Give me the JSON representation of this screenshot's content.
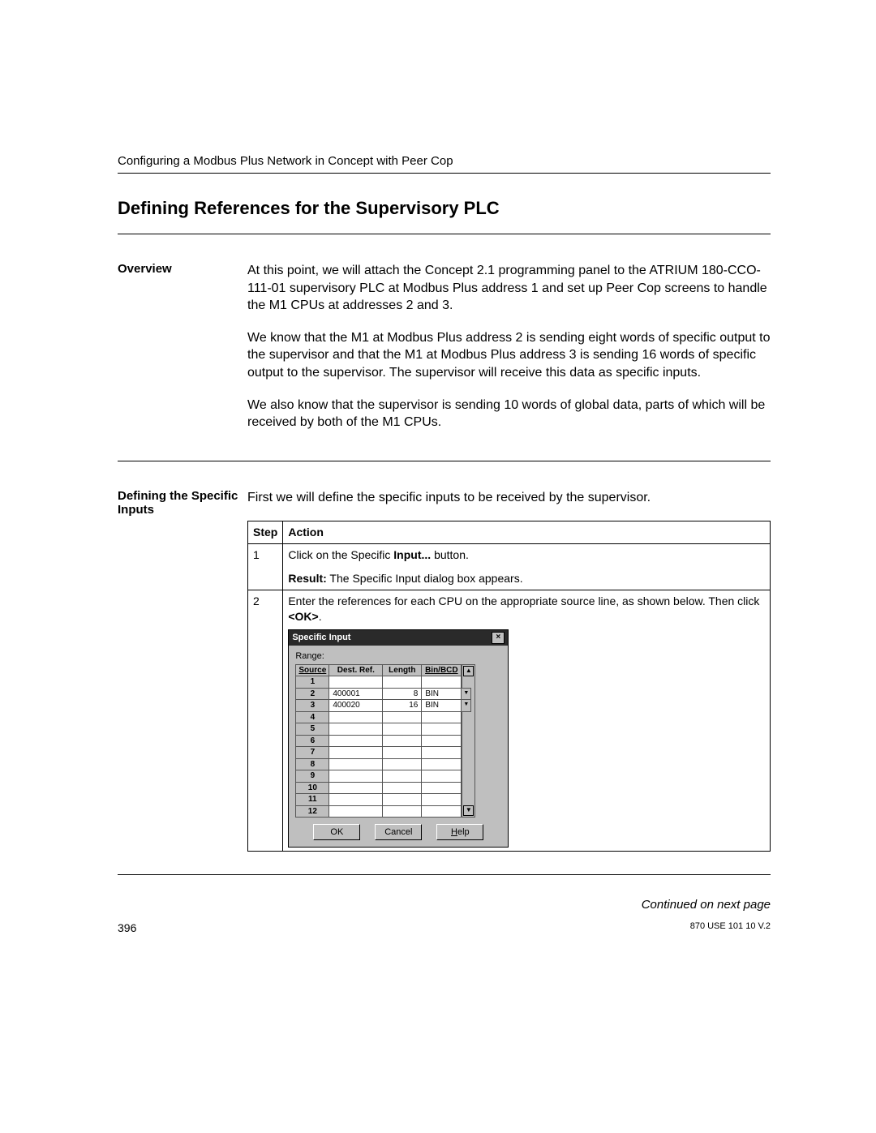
{
  "running_head": "Configuring a Modbus Plus Network in Concept with Peer Cop",
  "section_title": "Defining References for the Supervisory PLC",
  "overview": {
    "label": "Overview",
    "p1": "At this point, we will attach the Concept 2.1 programming panel to the ATRIUM 180-CCO-111-01 supervisory PLC at Modbus Plus address 1 and set up Peer Cop screens to handle the M1 CPUs at addresses 2 and 3.",
    "p2": "We know that the M1 at Modbus Plus address 2 is sending eight words of specific output to the supervisor and that the M1 at Modbus Plus address 3 is sending 16 words of specific output to the supervisor. The supervisor will receive this data as specific inputs.",
    "p3": "We also know that the supervisor is sending 10 words of global data, parts of which will be received by both of the M1 CPUs."
  },
  "specific_inputs": {
    "label": "Defining the Specific Inputs",
    "intro": "First we will define the specific inputs to be received by the supervisor.",
    "table": {
      "head_step": "Step",
      "head_action": "Action",
      "step1_num": "1",
      "step1_a": "Click on the Specific ",
      "step1_b": "Input...",
      "step1_c": " button.",
      "step1_result_label": "Result:",
      "step1_result_text": " The Specific Input dialog box appears.",
      "step2_num": "2",
      "step2_a": "Enter the references for each CPU on the appropriate source line, as shown below. Then click ",
      "step2_b": "<OK>",
      "step2_c": "."
    }
  },
  "dialog": {
    "title": "Specific Input",
    "range_label": "Range:",
    "cols": {
      "source": "Source",
      "dest": "Dest. Ref.",
      "length": "Length",
      "bin": "Bin/BCD"
    },
    "rows": [
      {
        "source": "1",
        "dest": "",
        "length": "",
        "bin": ""
      },
      {
        "source": "2",
        "dest": "400001",
        "length": "8",
        "bin": "BIN"
      },
      {
        "source": "3",
        "dest": "400020",
        "length": "16",
        "bin": "BIN"
      },
      {
        "source": "4",
        "dest": "",
        "length": "",
        "bin": ""
      },
      {
        "source": "5",
        "dest": "",
        "length": "",
        "bin": ""
      },
      {
        "source": "6",
        "dest": "",
        "length": "",
        "bin": ""
      },
      {
        "source": "7",
        "dest": "",
        "length": "",
        "bin": ""
      },
      {
        "source": "8",
        "dest": "",
        "length": "",
        "bin": ""
      },
      {
        "source": "9",
        "dest": "",
        "length": "",
        "bin": ""
      },
      {
        "source": "10",
        "dest": "",
        "length": "",
        "bin": ""
      },
      {
        "source": "11",
        "dest": "",
        "length": "",
        "bin": ""
      },
      {
        "source": "12",
        "dest": "",
        "length": "",
        "bin": ""
      }
    ],
    "buttons": {
      "ok": "OK",
      "cancel": "Cancel",
      "help_pre": "H",
      "help_rest": "elp"
    }
  },
  "continued": "Continued on next page",
  "footer": {
    "page": "396",
    "docid": "870 USE 101 10 V.2"
  }
}
